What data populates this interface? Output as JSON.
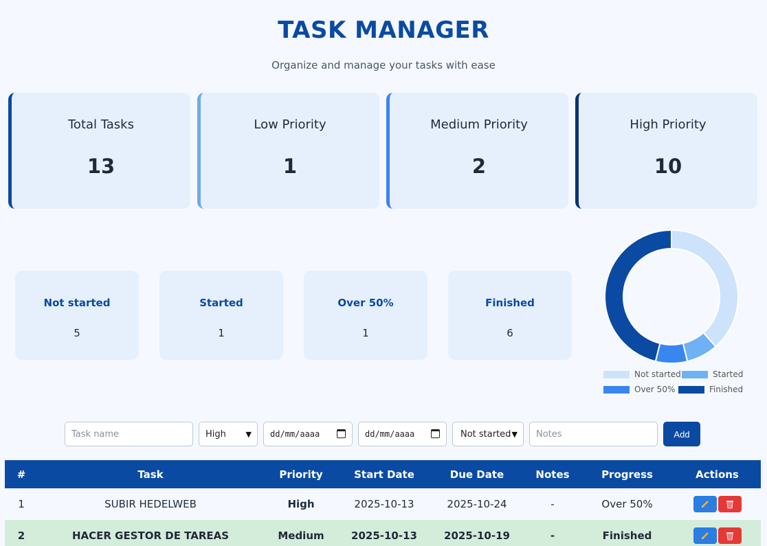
{
  "header": {
    "title": "TASK MANAGER",
    "subtitle": "Organize and manage your tasks with ease"
  },
  "stats": [
    {
      "label": "Total Tasks",
      "value": "13",
      "accent": "#0b4aa3"
    },
    {
      "label": "Low Priority",
      "value": "1",
      "accent": "#6fa9ee"
    },
    {
      "label": "Medium Priority",
      "value": "2",
      "accent": "#3b82f6"
    },
    {
      "label": "High Priority",
      "value": "10",
      "accent": "#0b3278"
    }
  ],
  "progress": [
    {
      "label": "Not started",
      "value": "5"
    },
    {
      "label": "Started",
      "value": "1"
    },
    {
      "label": "Over 50%",
      "value": "1"
    },
    {
      "label": "Finished",
      "value": "6"
    }
  ],
  "chart_data": {
    "type": "pie",
    "categories": [
      "Not started",
      "Started",
      "Over 50%",
      "Finished"
    ],
    "values": [
      5,
      1,
      1,
      6
    ],
    "colors": [
      "#cce3fb",
      "#6fb1f5",
      "#3a86f0",
      "#0b4aa3"
    ],
    "legend_position": "bottom"
  },
  "form": {
    "task_placeholder": "Task name",
    "priority_value": "High",
    "start_date_placeholder": "dd/mm/aaaa",
    "due_date_placeholder": "dd/mm/aaaa",
    "status_value": "Not started",
    "notes_placeholder": "Notes",
    "add_label": "Add"
  },
  "table": {
    "columns": [
      "#",
      "Task",
      "Priority",
      "Start Date",
      "Due Date",
      "Notes",
      "Progress",
      "Actions"
    ],
    "rows": [
      {
        "num": "1",
        "task": "SUBIR HEDELWEB",
        "priority": "High",
        "start": "2025-10-13",
        "due": "2025-10-24",
        "notes": "-",
        "progress": "Over 50%"
      },
      {
        "num": "2",
        "task": "HACER GESTOR DE TAREAS",
        "priority": "Medium",
        "start": "2025-10-13",
        "due": "2025-10-19",
        "notes": "-",
        "progress": "Finished"
      }
    ]
  }
}
